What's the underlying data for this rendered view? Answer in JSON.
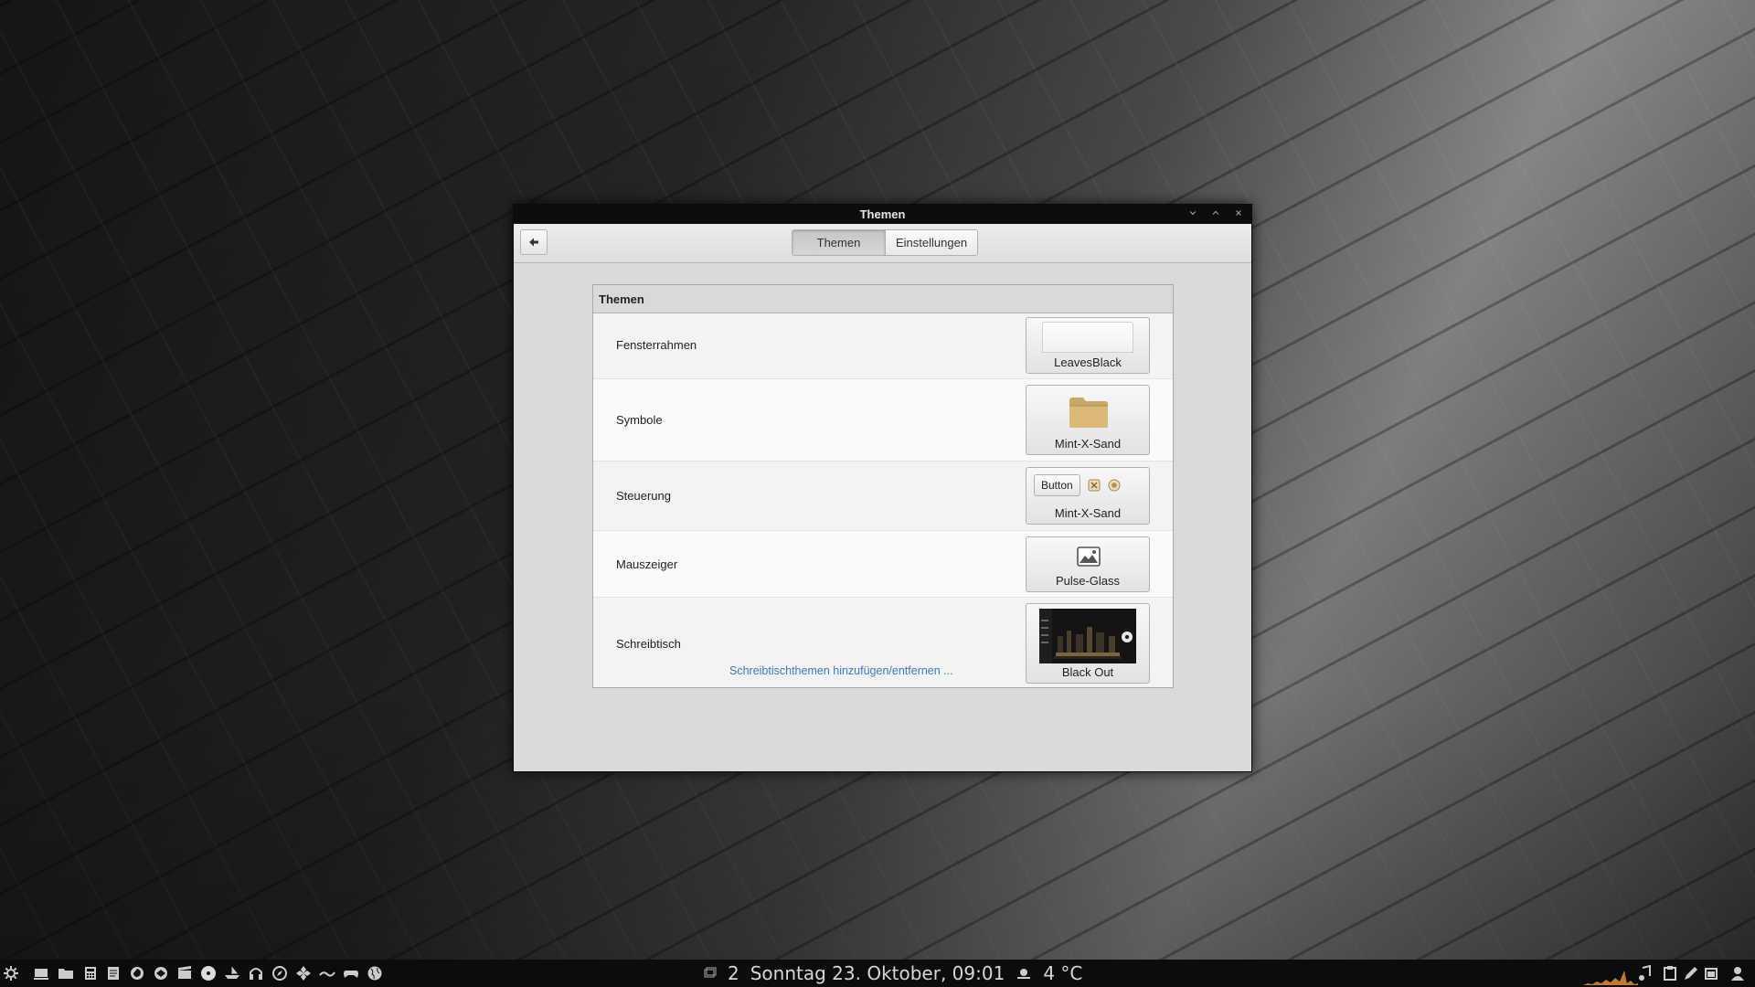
{
  "window": {
    "title": "Themen",
    "controls": [
      "minimize",
      "maximize",
      "close"
    ]
  },
  "toolbar": {
    "tabs": [
      {
        "label": "Themen",
        "active": true
      },
      {
        "label": "Einstellungen",
        "active": false
      }
    ]
  },
  "panel": {
    "header": "Themen",
    "rows": [
      {
        "label": "Fensterrahmen",
        "value": "LeavesBlack"
      },
      {
        "label": "Symbole",
        "value": "Mint-X-Sand"
      },
      {
        "label": "Steuerung",
        "value": "Mint-X-Sand",
        "preview_button": "Button"
      },
      {
        "label": "Mauszeiger",
        "value": "Pulse-Glass"
      },
      {
        "label": "Schreibtisch",
        "value": "Black Out"
      }
    ],
    "link": "Schreibtischthemen hinzufügen/entfernen ..."
  },
  "taskbar": {
    "workspace": "2",
    "datetime": "Sonntag 23. Oktober, 09:01",
    "temperature": "4 °C",
    "launchers": [
      "menu-icon",
      "show-desktop-icon",
      "files-icon",
      "calculator-icon",
      "text-editor-icon",
      "firefox-icon",
      "thunderbird-icon",
      "video-icon",
      "disc-icon",
      "boat-icon",
      "headphones-icon",
      "compass-icon",
      "network-icon",
      "gamepad-icon",
      "globe-icon"
    ]
  },
  "colors": {
    "link": "#3a7bbf",
    "titlebar": "#0d0d0d",
    "taskbar": "#0c0c0c"
  }
}
